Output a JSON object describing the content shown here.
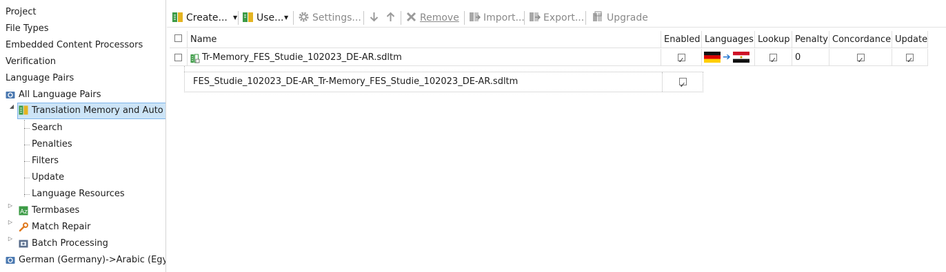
{
  "tree": {
    "items": [
      {
        "label": "Project"
      },
      {
        "label": "File Types"
      },
      {
        "label": "Embedded Content Processors"
      },
      {
        "label": "Verification"
      },
      {
        "label": "Language Pairs"
      },
      {
        "label": "All Language Pairs",
        "icon": "language-pair-icon"
      },
      {
        "label": "Translation Memory and Auto",
        "icon": "translation-memory-icon",
        "selected": true
      },
      {
        "label": "Search"
      },
      {
        "label": "Penalties"
      },
      {
        "label": "Filters"
      },
      {
        "label": "Update"
      },
      {
        "label": "Language Resources"
      },
      {
        "label": "Termbases",
        "icon": "termbase-icon"
      },
      {
        "label": "Match Repair",
        "icon": "wrench-icon"
      },
      {
        "label": "Batch Processing",
        "icon": "batch-icon"
      },
      {
        "label": "German (Germany)->Arabic (Egy",
        "icon": "language-pair-icon"
      }
    ]
  },
  "toolbar": {
    "create": "Create...",
    "use": "Use...",
    "settings": "Settings...",
    "remove": "Remove",
    "import": "Import...",
    "export": "Export...",
    "upgrade": "Upgrade"
  },
  "grid": {
    "columns": [
      "Name",
      "Enabled",
      "Languages",
      "Lookup",
      "Penalty",
      "Concordance",
      "Update"
    ],
    "rows": [
      {
        "name": "Tr-Memory_FES_Studie_102023_DE-AR.sdltm",
        "selected": false,
        "enabled": true,
        "source_language": "German",
        "target_language": "Arabic (Egypt)",
        "lookup": true,
        "penalty": "0",
        "concordance": true,
        "update": true
      }
    ],
    "subrow": {
      "name": "FES_Studie_102023_DE-AR_Tr-Memory_FES_Studie_102023_DE-AR.sdltm",
      "enabled": true
    }
  },
  "colors": {
    "selection_bg": "#cce4f7",
    "selection_border": "#7eb4ea",
    "disabled_text": "#8a8a8a",
    "arrow": "#2b7cd3"
  }
}
